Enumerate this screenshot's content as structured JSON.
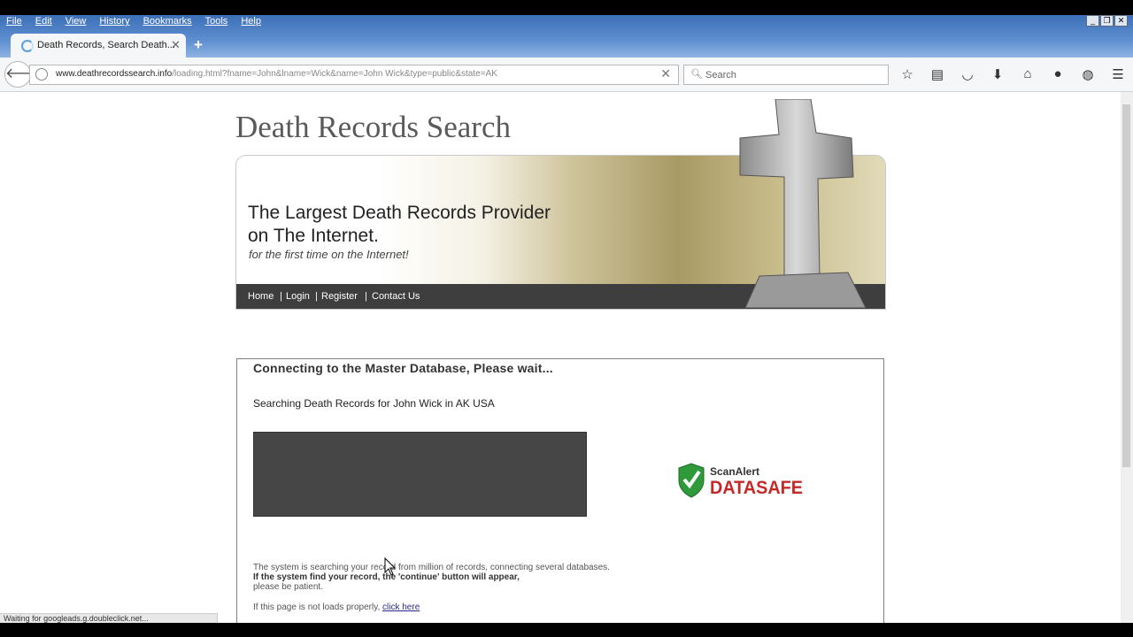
{
  "menu": [
    "File",
    "Edit",
    "View",
    "History",
    "Bookmarks",
    "Tools",
    "Help"
  ],
  "tab": {
    "title": "Death Records, Search Death..."
  },
  "url": {
    "domain": "www.deathrecordssearch.info",
    "path": "/loading.html?fname=John&lname=Wick&name=John Wick&type=public&state=AK"
  },
  "search": {
    "placeholder": "Search"
  },
  "site": {
    "title": "Death Records Search",
    "headline1": "The Largest Death Records Provider",
    "headline2": "on The Internet.",
    "subline": "for the first time on the Internet!",
    "nav": [
      "Home",
      "Login",
      "Register",
      "Contact Us"
    ]
  },
  "loading": {
    "heading": "Connecting to the Master Database, Please wait...",
    "searching": "Searching Death Records for John Wick in AK USA",
    "badge_top": "ScanAlert",
    "badge_bottom": "DATASAFE",
    "info1": "The system is searching your record from million of records, connecting several databases.",
    "info2": "If the system find your record, the 'continue' button will appear,",
    "info3": "please be patient.",
    "fallback": "If this page is not loads properly,",
    "fallback_link": "click here"
  },
  "status": "Waiting for googleads.g.doubleclick.net..."
}
